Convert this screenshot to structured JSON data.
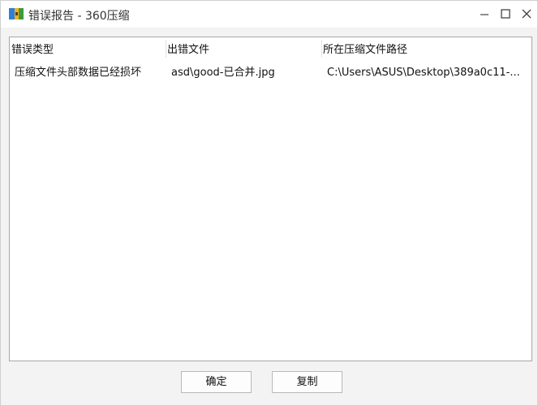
{
  "window": {
    "title": "错误报告 - 360压缩",
    "accent": "#2f7fd8"
  },
  "table": {
    "columns": [
      "错误类型",
      "出错文件",
      "所在压缩文件路径"
    ],
    "rows": [
      [
        "压缩文件头部数据已经损坏",
        "asd\\good-已合并.jpg",
        "C:\\Users\\ASUS\\Desktop\\389a0c11-..."
      ]
    ]
  },
  "buttons": {
    "ok_label": "确定",
    "copy_label": "复制"
  }
}
